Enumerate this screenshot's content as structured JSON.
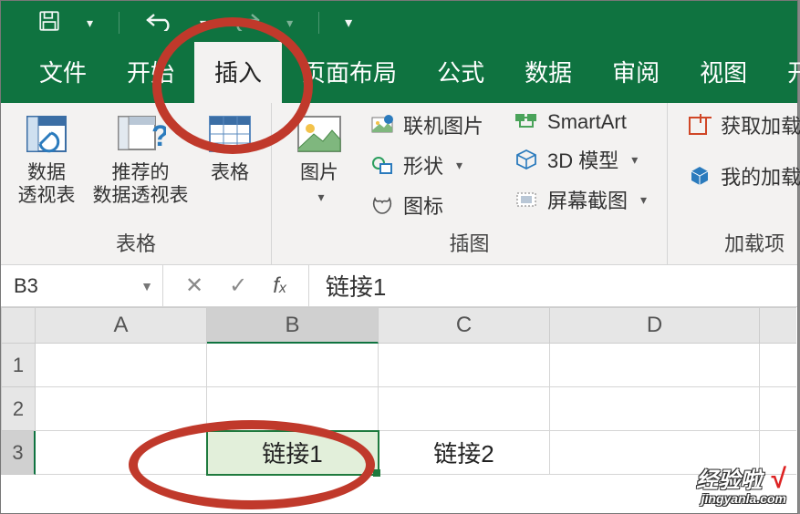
{
  "titlebar": {
    "save_icon": "save-icon",
    "undo_icon": "undo-icon",
    "redo_icon": "redo-icon"
  },
  "tabs": {
    "file": "文件",
    "home": "开始",
    "insert": "插入",
    "layout": "页面布局",
    "formulas": "公式",
    "data": "数据",
    "review": "审阅",
    "view": "视图",
    "dev": "开发工具"
  },
  "ribbon": {
    "group_tables": "表格",
    "pt_label1": "数据",
    "pt_label2": "透视表",
    "rec_label1": "推荐的",
    "rec_label2": "数据透视表",
    "table_label": "表格",
    "group_illus": "插图",
    "pic_label": "图片",
    "online_pic": "联机图片",
    "shapes": "形状",
    "icons": "图标",
    "smartart": "SmartArt",
    "model3d": "3D 模型",
    "screenshot": "屏幕截图",
    "group_addins": "加载项",
    "get_addins": "获取加载项",
    "my_addins": "我的加载项"
  },
  "formula_bar": {
    "cell_ref": "B3",
    "cell_value": "链接1"
  },
  "sheet": {
    "cols": [
      "A",
      "B",
      "C",
      "D"
    ],
    "rows": [
      "1",
      "2",
      "3"
    ],
    "b3": "链接1",
    "c3": "链接2"
  },
  "watermark": {
    "line1": "经验啦",
    "line2": "jingyanla.com",
    "check": "√"
  }
}
